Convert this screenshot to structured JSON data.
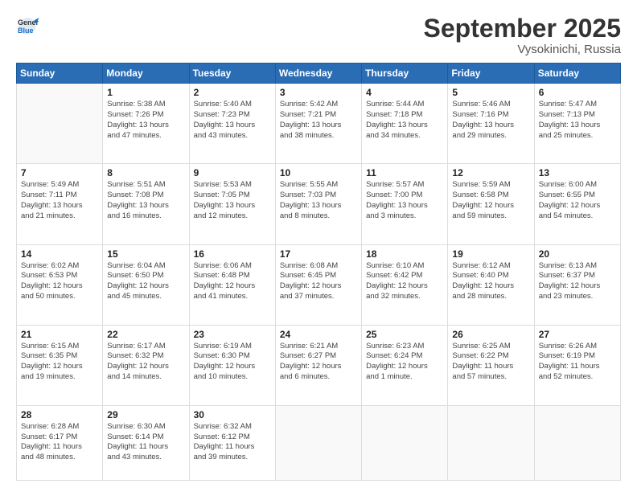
{
  "header": {
    "logo_line1": "General",
    "logo_line2": "Blue",
    "month": "September 2025",
    "location": "Vysokinichi, Russia"
  },
  "weekdays": [
    "Sunday",
    "Monday",
    "Tuesday",
    "Wednesday",
    "Thursday",
    "Friday",
    "Saturday"
  ],
  "weeks": [
    [
      {
        "day": "",
        "info": ""
      },
      {
        "day": "1",
        "info": "Sunrise: 5:38 AM\nSunset: 7:26 PM\nDaylight: 13 hours\nand 47 minutes."
      },
      {
        "day": "2",
        "info": "Sunrise: 5:40 AM\nSunset: 7:23 PM\nDaylight: 13 hours\nand 43 minutes."
      },
      {
        "day": "3",
        "info": "Sunrise: 5:42 AM\nSunset: 7:21 PM\nDaylight: 13 hours\nand 38 minutes."
      },
      {
        "day": "4",
        "info": "Sunrise: 5:44 AM\nSunset: 7:18 PM\nDaylight: 13 hours\nand 34 minutes."
      },
      {
        "day": "5",
        "info": "Sunrise: 5:46 AM\nSunset: 7:16 PM\nDaylight: 13 hours\nand 29 minutes."
      },
      {
        "day": "6",
        "info": "Sunrise: 5:47 AM\nSunset: 7:13 PM\nDaylight: 13 hours\nand 25 minutes."
      }
    ],
    [
      {
        "day": "7",
        "info": "Sunrise: 5:49 AM\nSunset: 7:11 PM\nDaylight: 13 hours\nand 21 minutes."
      },
      {
        "day": "8",
        "info": "Sunrise: 5:51 AM\nSunset: 7:08 PM\nDaylight: 13 hours\nand 16 minutes."
      },
      {
        "day": "9",
        "info": "Sunrise: 5:53 AM\nSunset: 7:05 PM\nDaylight: 13 hours\nand 12 minutes."
      },
      {
        "day": "10",
        "info": "Sunrise: 5:55 AM\nSunset: 7:03 PM\nDaylight: 13 hours\nand 8 minutes."
      },
      {
        "day": "11",
        "info": "Sunrise: 5:57 AM\nSunset: 7:00 PM\nDaylight: 13 hours\nand 3 minutes."
      },
      {
        "day": "12",
        "info": "Sunrise: 5:59 AM\nSunset: 6:58 PM\nDaylight: 12 hours\nand 59 minutes."
      },
      {
        "day": "13",
        "info": "Sunrise: 6:00 AM\nSunset: 6:55 PM\nDaylight: 12 hours\nand 54 minutes."
      }
    ],
    [
      {
        "day": "14",
        "info": "Sunrise: 6:02 AM\nSunset: 6:53 PM\nDaylight: 12 hours\nand 50 minutes."
      },
      {
        "day": "15",
        "info": "Sunrise: 6:04 AM\nSunset: 6:50 PM\nDaylight: 12 hours\nand 45 minutes."
      },
      {
        "day": "16",
        "info": "Sunrise: 6:06 AM\nSunset: 6:48 PM\nDaylight: 12 hours\nand 41 minutes."
      },
      {
        "day": "17",
        "info": "Sunrise: 6:08 AM\nSunset: 6:45 PM\nDaylight: 12 hours\nand 37 minutes."
      },
      {
        "day": "18",
        "info": "Sunrise: 6:10 AM\nSunset: 6:42 PM\nDaylight: 12 hours\nand 32 minutes."
      },
      {
        "day": "19",
        "info": "Sunrise: 6:12 AM\nSunset: 6:40 PM\nDaylight: 12 hours\nand 28 minutes."
      },
      {
        "day": "20",
        "info": "Sunrise: 6:13 AM\nSunset: 6:37 PM\nDaylight: 12 hours\nand 23 minutes."
      }
    ],
    [
      {
        "day": "21",
        "info": "Sunrise: 6:15 AM\nSunset: 6:35 PM\nDaylight: 12 hours\nand 19 minutes."
      },
      {
        "day": "22",
        "info": "Sunrise: 6:17 AM\nSunset: 6:32 PM\nDaylight: 12 hours\nand 14 minutes."
      },
      {
        "day": "23",
        "info": "Sunrise: 6:19 AM\nSunset: 6:30 PM\nDaylight: 12 hours\nand 10 minutes."
      },
      {
        "day": "24",
        "info": "Sunrise: 6:21 AM\nSunset: 6:27 PM\nDaylight: 12 hours\nand 6 minutes."
      },
      {
        "day": "25",
        "info": "Sunrise: 6:23 AM\nSunset: 6:24 PM\nDaylight: 12 hours\nand 1 minute."
      },
      {
        "day": "26",
        "info": "Sunrise: 6:25 AM\nSunset: 6:22 PM\nDaylight: 11 hours\nand 57 minutes."
      },
      {
        "day": "27",
        "info": "Sunrise: 6:26 AM\nSunset: 6:19 PM\nDaylight: 11 hours\nand 52 minutes."
      }
    ],
    [
      {
        "day": "28",
        "info": "Sunrise: 6:28 AM\nSunset: 6:17 PM\nDaylight: 11 hours\nand 48 minutes."
      },
      {
        "day": "29",
        "info": "Sunrise: 6:30 AM\nSunset: 6:14 PM\nDaylight: 11 hours\nand 43 minutes."
      },
      {
        "day": "30",
        "info": "Sunrise: 6:32 AM\nSunset: 6:12 PM\nDaylight: 11 hours\nand 39 minutes."
      },
      {
        "day": "",
        "info": ""
      },
      {
        "day": "",
        "info": ""
      },
      {
        "day": "",
        "info": ""
      },
      {
        "day": "",
        "info": ""
      }
    ]
  ]
}
